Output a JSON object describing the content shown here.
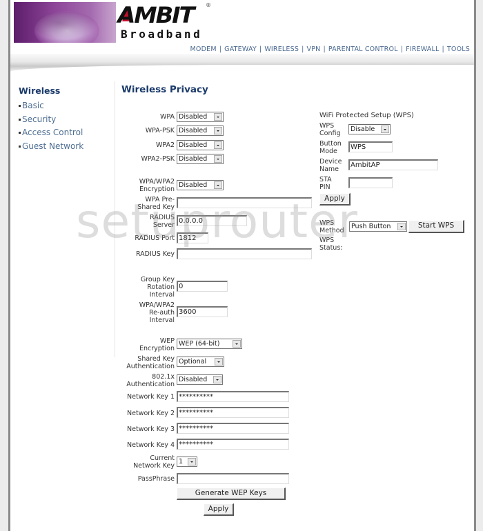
{
  "brand": {
    "logo_name": "AMBIT",
    "logo_sub": "Broadband",
    "registered": "®"
  },
  "topnav": {
    "items": [
      "MODEM",
      "GATEWAY",
      "WIRELESS",
      "VPN",
      "PARENTAL CONTROL",
      "FIREWALL",
      "TOOLS"
    ],
    "separator": "|"
  },
  "sidebar": {
    "title": "Wireless",
    "items": [
      {
        "label": "Basic"
      },
      {
        "label": "Security"
      },
      {
        "label": "Access Control"
      },
      {
        "label": "Guest Network"
      }
    ]
  },
  "page_title": "Wireless Privacy",
  "wpa": {
    "wpa": {
      "label": "WPA",
      "value": "Disabled"
    },
    "wpa_psk": {
      "label": "WPA-PSK",
      "value": "Disabled"
    },
    "wpa2": {
      "label": "WPA2",
      "value": "Disabled"
    },
    "wpa2_psk": {
      "label": "WPA2-PSK",
      "value": "Disabled"
    },
    "encryption": {
      "label_1": "WPA/WPA2",
      "label_2": "Encryption",
      "value": "Disabled"
    },
    "psk": {
      "label_1": "WPA Pre-",
      "label_2": "Shared Key",
      "value": ""
    },
    "radius_server": {
      "label_1": "RADIUS",
      "label_2": "Server",
      "value": "0.0.0.0"
    },
    "radius_port": {
      "label": "RADIUS Port",
      "value": "1812"
    },
    "radius_key": {
      "label": "RADIUS Key",
      "value": ""
    },
    "group_key": {
      "label_1": "Group Key",
      "label_2": "Rotation",
      "label_3": "Interval",
      "value": "0"
    },
    "reauth": {
      "label_1": "WPA/WPA2",
      "label_2": "Re-auth",
      "label_3": "Interval",
      "value": "3600"
    }
  },
  "wep": {
    "encryption": {
      "label_1": "WEP",
      "label_2": "Encryption",
      "value": "WEP (64-bit)"
    },
    "shared_key": {
      "label_1": "Shared Key",
      "label_2": "Authentication",
      "value": "Optional"
    },
    "dot1x": {
      "label_1": "802.1x",
      "label_2": "Authentication",
      "value": "Disabled"
    },
    "keys": [
      {
        "label": "Network Key 1",
        "value": "**********"
      },
      {
        "label": "Network Key 2",
        "value": "**********"
      },
      {
        "label": "Network Key 3",
        "value": "**********"
      },
      {
        "label": "Network Key 4",
        "value": "**********"
      }
    ],
    "current_key": {
      "label_1": "Current",
      "label_2": "Network Key",
      "value": "1"
    },
    "passphrase": {
      "label": "PassPhrase",
      "value": ""
    },
    "generate_label": "Generate WEP Keys",
    "apply_label": "Apply"
  },
  "wps": {
    "title": "WiFi Protected Setup (WPS)",
    "config": {
      "label_1": "WPS",
      "label_2": "Config",
      "value": "Disable"
    },
    "button_mode": {
      "label_1": "Button",
      "label_2": "Mode",
      "value": "WPS"
    },
    "device_name": {
      "label_1": "Device",
      "label_2": "Name",
      "value": "AmbitAP"
    },
    "sta_pin": {
      "label_1": "STA",
      "label_2": "PIN",
      "value": ""
    },
    "apply_label": "Apply",
    "method": {
      "label_1": "WPS",
      "label_2": "Method",
      "value": "Push Button"
    },
    "start_label": "Start WPS",
    "status": {
      "label_1": "WPS",
      "label_2": "Status:",
      "value": ""
    }
  },
  "watermark": "setuprouter"
}
